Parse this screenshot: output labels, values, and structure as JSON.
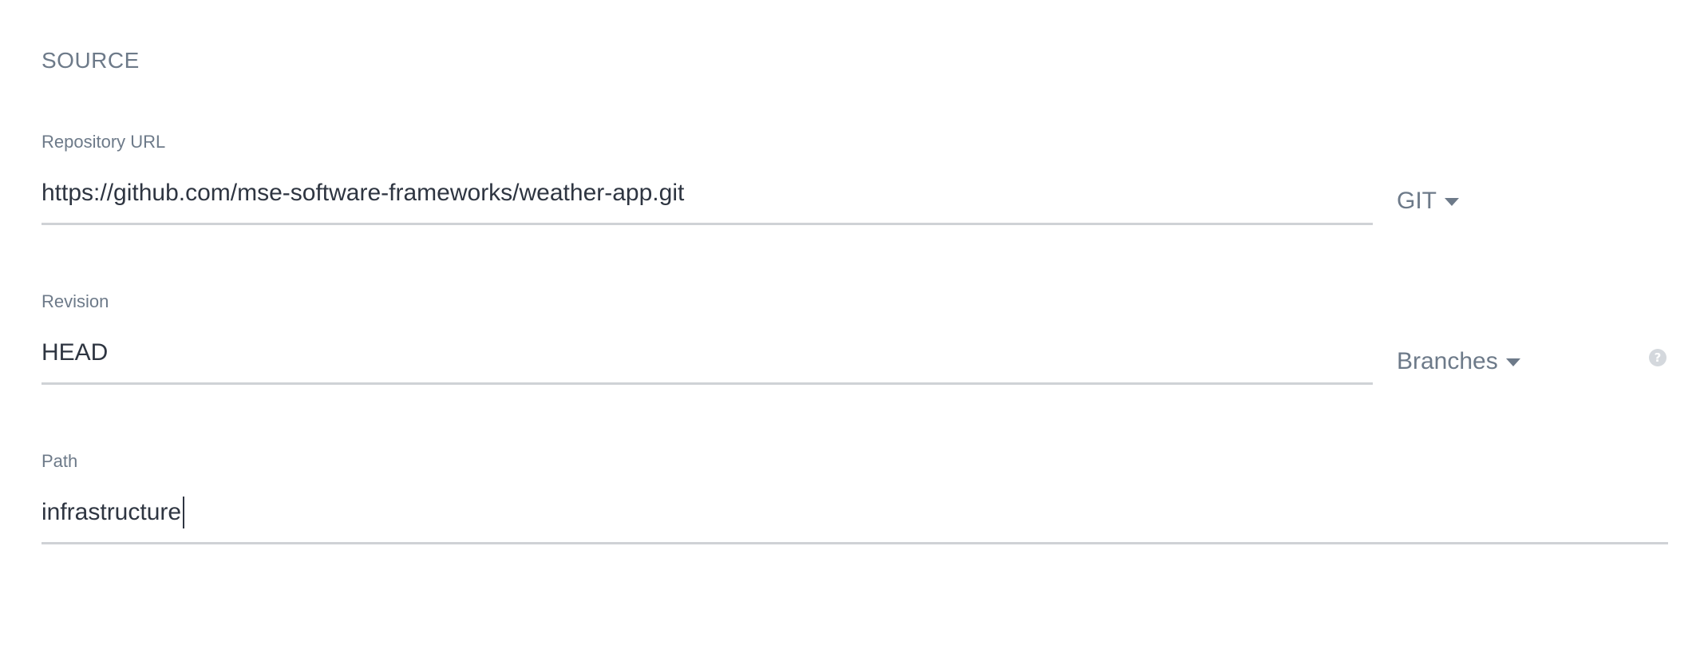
{
  "section": {
    "title": "SOURCE"
  },
  "fields": {
    "repo_url": {
      "label": "Repository URL",
      "value": "https://github.com/mse-software-frameworks/weather-app.git"
    },
    "revision": {
      "label": "Revision",
      "value": "HEAD"
    },
    "path": {
      "label": "Path",
      "value": "infrastructure"
    }
  },
  "dropdowns": {
    "repo_type": {
      "value": "GIT",
      "icon": "chevron-down-icon"
    },
    "revision_type": {
      "value": "Branches",
      "icon": "chevron-down-icon"
    }
  },
  "help": {
    "icon": "help-circle-icon",
    "glyph": "?"
  },
  "colors": {
    "label": "#6d7a89",
    "text": "#2e3541",
    "underline": "#cfd2d6",
    "help_icon": "#d4d8dd"
  }
}
